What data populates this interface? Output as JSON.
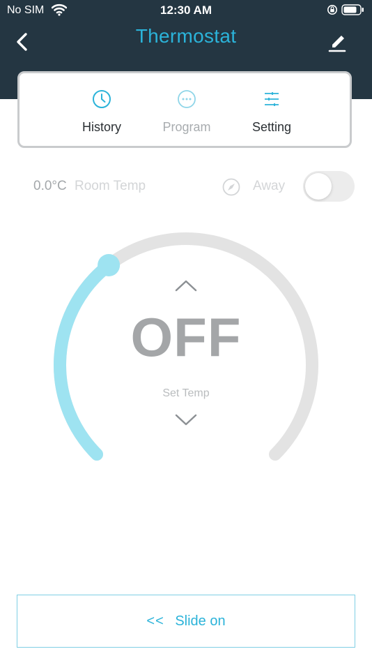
{
  "status_bar": {
    "carrier": "No SIM",
    "time": "12:30 AM"
  },
  "header": {
    "title": "Thermostat",
    "back_icon": "chevron-left-icon",
    "edit_icon": "pencil-icon"
  },
  "tabs": [
    {
      "label": "History",
      "icon": "clock-icon",
      "state": "default"
    },
    {
      "label": "Program",
      "icon": "more-horizontal-icon",
      "state": "disabled"
    },
    {
      "label": "Setting",
      "icon": "sliders-icon",
      "state": "default"
    }
  ],
  "room": {
    "temperature": "0.0°C",
    "label": "Room Temp"
  },
  "away": {
    "label": "Away",
    "enabled": false
  },
  "dial": {
    "display": "OFF",
    "label": "Set Temp",
    "setpoint_fraction": 0.36
  },
  "slide_button": {
    "arrows": "<<",
    "label": "Slide on"
  },
  "colors": {
    "header_background": "#243642",
    "accent": "#2bb3d9",
    "arc_active": "#9ee3f1",
    "arc_track": "#e3e3e3"
  }
}
